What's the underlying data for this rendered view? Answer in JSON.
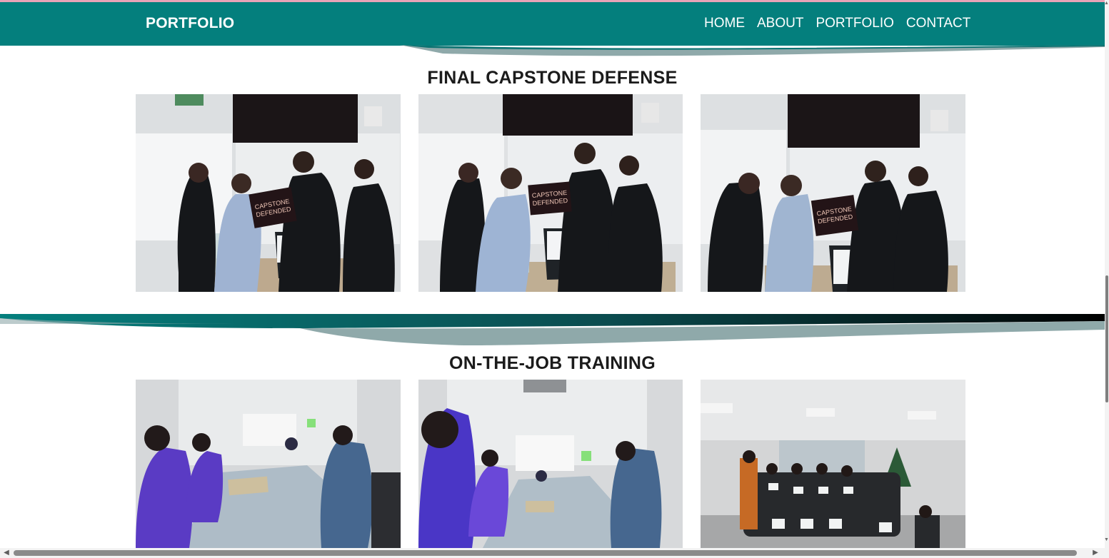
{
  "navbar": {
    "brand": "PORTFOLIO",
    "links": [
      "HOME",
      "ABOUT",
      "PORTFOLIO",
      "CONTACT"
    ],
    "color": "#047f7d"
  },
  "sections": [
    {
      "title": "FINAL CAPSTONE DEFENSE",
      "photos": [
        {
          "sign_line1": "CAPSTONE",
          "sign_line2": "DEFENDED"
        },
        {
          "sign_line1": "CAPSTONE",
          "sign_line2": "DEFENDED"
        },
        {
          "sign_line1": "CAPSTONE",
          "sign_line2": "DEFENDED"
        }
      ]
    },
    {
      "title": "ON-THE-JOB TRAINING",
      "photos": [
        {
          "scene": "meeting-room"
        },
        {
          "scene": "meeting-room"
        },
        {
          "scene": "group-certificates"
        }
      ]
    }
  ]
}
